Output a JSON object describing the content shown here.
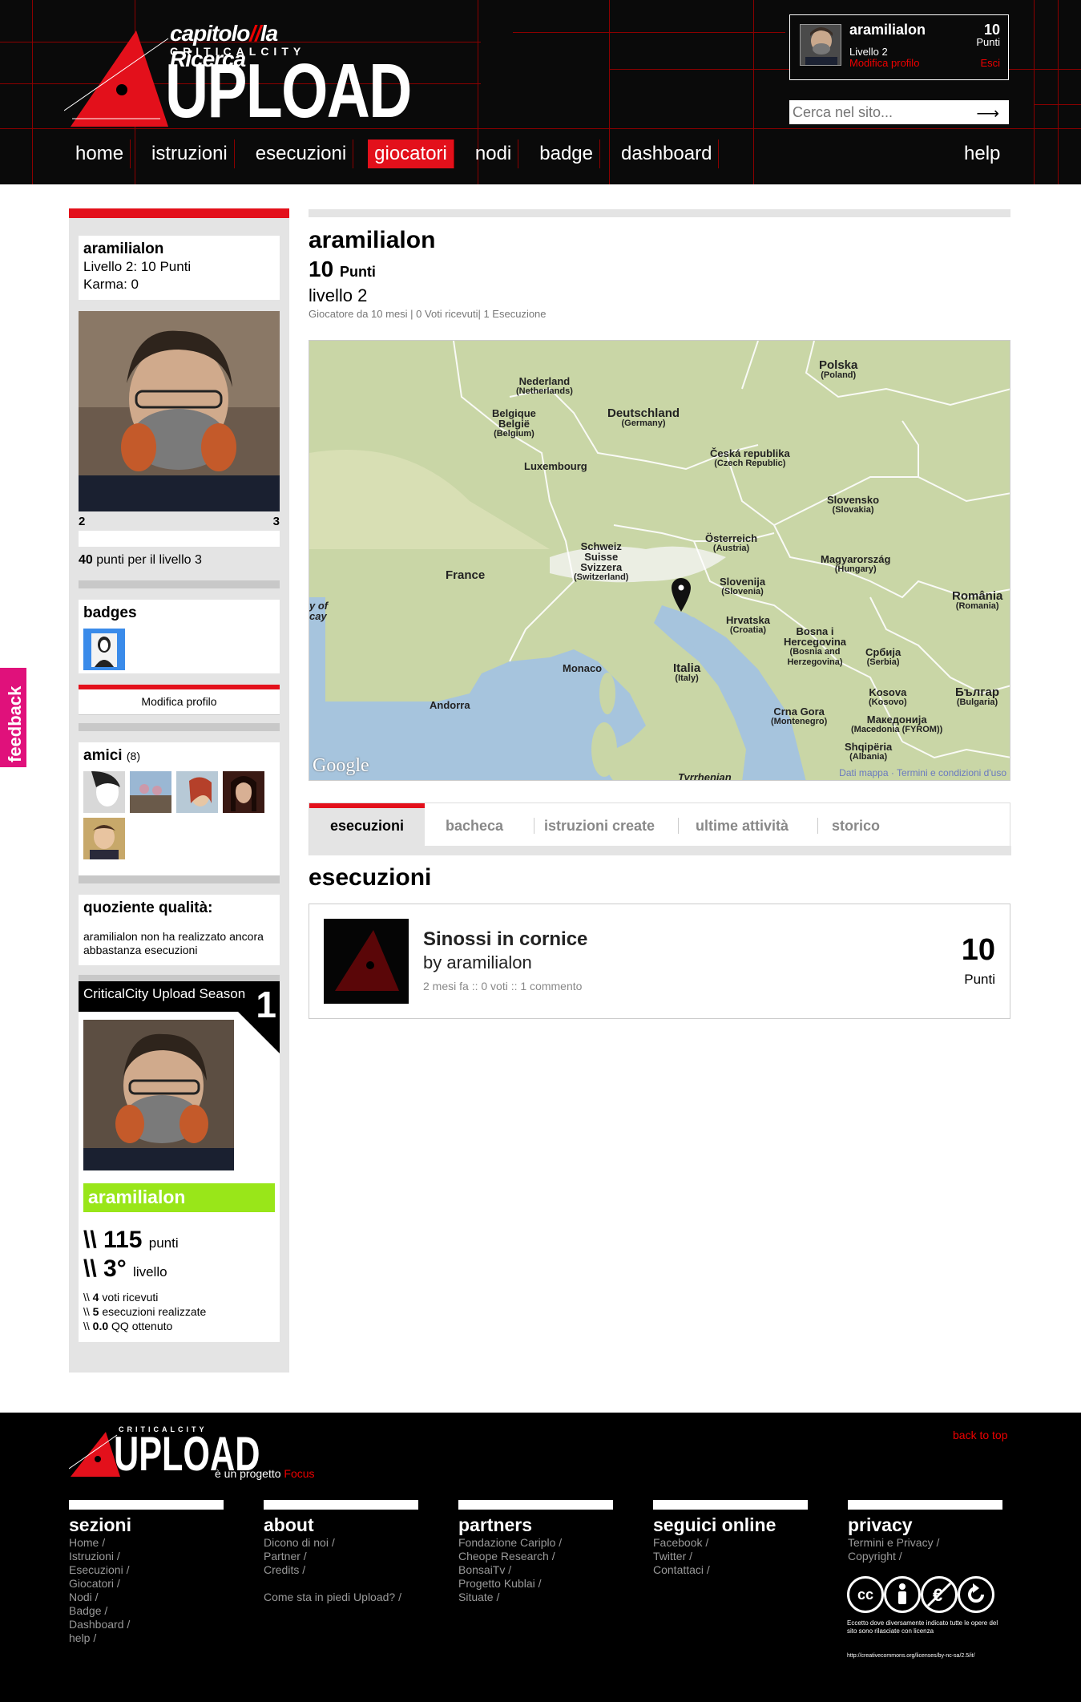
{
  "header": {
    "logo": {
      "chapter": "capitolo",
      "chapter_title": "la Ricerca",
      "brand_sub": "CRITICALCITY",
      "brand": "UPLOAD"
    },
    "nav": [
      "home",
      "istruzioni",
      "esecuzioni",
      "giocatori",
      "nodi",
      "badge",
      "dashboard"
    ],
    "nav_active": "giocatori",
    "help": "help",
    "user": {
      "name": "aramilialon",
      "level": "Livello 2",
      "edit": "Modifica profilo",
      "points": "10",
      "points_label": "Punti",
      "exit": "Esci"
    },
    "search": {
      "placeholder": "Cerca nel sito...",
      "arrow": "⟶"
    }
  },
  "sidebar": {
    "profile": {
      "name": "aramilialon",
      "level_line": "Livello 2: 10 Punti",
      "karma_line": "Karma: 0"
    },
    "level_current": "2",
    "level_next": "3",
    "points_to_next": "40",
    "points_to_next_label": "punti per il livello 3",
    "badges_title": "badges",
    "edit_profile": "Modifica profilo",
    "friends_title": "amici",
    "friends_count": "(8)",
    "qq_title": "quoziente qualità:",
    "qq_text": "aramilialon non ha realizzato ancora abbastanza esecuzioni",
    "season": {
      "title": "CriticalCity Upload Season",
      "number": "1",
      "name": "aramilialon",
      "prefix": "\\\\",
      "points_value": "115",
      "points_label": "punti",
      "level_value": "3°",
      "level_label": "livello",
      "votes_value": "4",
      "votes_label": "voti ricevuti",
      "exec_value": "5",
      "exec_label": "esecuzioni realizzate",
      "qq_value": "0.0",
      "qq_label": "QQ ottenuto"
    }
  },
  "main": {
    "name": "aramilialon",
    "points": "10",
    "points_label": "Punti",
    "level": "livello 2",
    "stats": "Giocatore da 10 mesi | 0 Voti ricevuti| 1 Esecuzione",
    "map": {
      "google": "Google",
      "credits": "Dati mappa · Termini e condizioni d'uso",
      "labels": {
        "nederland": "Nederland",
        "nederland_sub": "(Netherlands)",
        "belgique": "Belgique\nBelgië",
        "belgique_sub": "(Belgium)",
        "luxembourg": "Luxembourg",
        "deutschland": "Deutschland",
        "deutschland_sub": "(Germany)",
        "polska": "Polska",
        "polska_sub": "(Poland)",
        "cesko": "Česká republika",
        "cesko_sub": "(Czech Republic)",
        "slovensko": "Slovensko",
        "slovensko_sub": "(Slovakia)",
        "osterreich": "Österreich",
        "osterreich_sub": "(Austria)",
        "magyar": "Magyarország",
        "magyar_sub": "(Hungary)",
        "schweiz": "Schweiz\nSuisse\nSvizzera",
        "schweiz_sub": "(Switzerland)",
        "france": "France",
        "slovenija": "Slovenija",
        "slovenija_sub": "(Slovenia)",
        "hrvatska": "Hrvatska",
        "hrvatska_sub": "(Croatia)",
        "romania": "România",
        "romania_sub": "(Romania)",
        "bosna": "Bosna i\nHercegovina",
        "bosna_sub": "(Bosnia and\nHerzegovina)",
        "srbija": "Србија",
        "srbija_sub": "(Serbia)",
        "monaco": "Monaco",
        "italia": "Italia",
        "italia_sub": "(Italy)",
        "andorra": "Andorra",
        "crnagora": "Crna Gora",
        "crnagora_sub": "(Montenegro)",
        "kosovo": "Kosova",
        "kosovo_sub": "(Kosovo)",
        "bulgaria": "Българ",
        "bulgaria_sub": "(Bulgaria)",
        "macedonia": "Македонија",
        "macedonia_sub": "(Macedonia (FYROM))",
        "shqiperia": "Shqipëria",
        "shqiperia_sub": "(Albania)",
        "tyrrhenian": "Tyrrhenian",
        "bay": "y of\ncay"
      }
    },
    "tabs": [
      "esecuzioni",
      "bacheca",
      "istruzioni create",
      "ultime attività",
      "storico"
    ],
    "section_title": "esecuzioni",
    "execution": {
      "title": "Sinossi in cornice",
      "by": "by aramilialon",
      "meta": "2 mesi fa :: 0 voti :: 1 commento",
      "points": "10",
      "points_label": "Punti"
    }
  },
  "feedback": "feedback",
  "footer": {
    "logo_sub": "CRITICALCITY",
    "logo": "UPLOAD",
    "project_text": "è un progetto",
    "project_link": "Focus",
    "back_to_top": "back to top",
    "columns": [
      {
        "title": "sezioni",
        "links": [
          "Home /",
          "Istruzioni /",
          "Esecuzioni /",
          "Giocatori /",
          "Nodi /",
          "Badge /",
          "Dashboard /",
          "help /"
        ]
      },
      {
        "title": "about",
        "links": [
          "Dicono di noi /",
          "Partner /",
          "Credits /",
          "",
          "Come sta in piedi Upload? /"
        ]
      },
      {
        "title": "partners",
        "links": [
          "Fondazione Cariplo /",
          "Cheope Research /",
          "BonsaiTv /",
          "Progetto Kublai /",
          "Situate /"
        ]
      },
      {
        "title": "seguici online",
        "links": [
          "Facebook /",
          "Twitter /",
          "Contattaci /"
        ]
      },
      {
        "title": "privacy",
        "links": [
          "Termini e Privacy /",
          "Copyright /"
        ]
      }
    ],
    "cc_note": "Eccetto dove diversamente indicato tutte le opere del sito sono rilasciate con licenza",
    "cc_url": "http://creativecommons.org/licenses/by-nc-sa/2.5/it/",
    "cc_icons": [
      "cc",
      "by",
      "nc",
      "sa"
    ]
  },
  "colors": {
    "accent_red": "#e3101b",
    "feedback_pink": "#e0117b",
    "season_green": "#99e619"
  }
}
